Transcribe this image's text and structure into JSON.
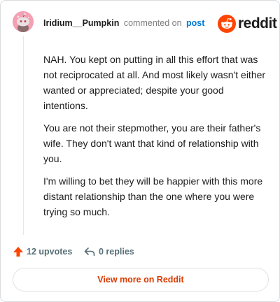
{
  "header": {
    "username": "Iridium__Pumpkin",
    "commented_text": "commented on",
    "post_link": "post",
    "logo_text": "reddit"
  },
  "comment": {
    "paragraphs": [
      "NAH. You kept on putting in all this effort that was not reciprocated at all. And most likely wasn't either wanted or appreciated; despite your good intentions.",
      "You are not their stepmother, you are their father's wife. They don't want that kind of relationship with you.",
      "I'm willing to bet they will be happier with this more distant relationship than the one where you were trying so much."
    ]
  },
  "actions": {
    "upvotes": "12 upvotes",
    "replies": "0 replies"
  },
  "cta": {
    "label": "View more on Reddit"
  },
  "colors": {
    "brand": "#ff4500",
    "link": "#0079d3",
    "cta_text": "#d93a00",
    "avatar_bg": "#f4a0b3"
  },
  "icons": [
    "upvote-icon",
    "reply-icon",
    "reddit-logo-icon",
    "avatar"
  ]
}
